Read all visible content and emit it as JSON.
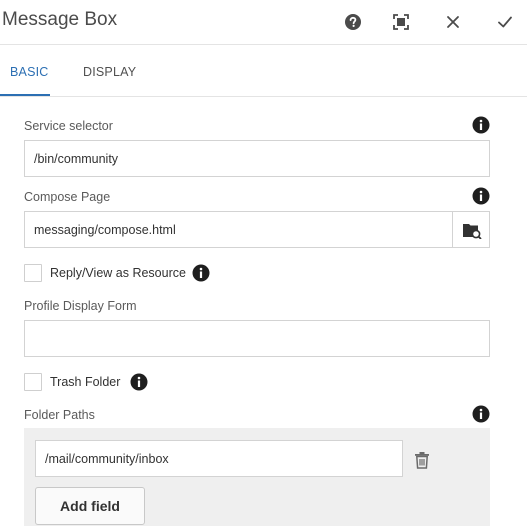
{
  "dialog": {
    "title": "Message Box",
    "toolbar": {
      "help": "help-icon",
      "fullscreen": "fullscreen-icon",
      "close": "close-icon",
      "done": "check-icon"
    }
  },
  "tabs": [
    {
      "label": "BASIC",
      "active": true
    },
    {
      "label": "DISPLAY",
      "active": false
    }
  ],
  "fields": {
    "service_selector": {
      "label": "Service selector",
      "value": "/bin/community"
    },
    "compose_page": {
      "label": "Compose Page",
      "value": "messaging/compose.html"
    },
    "reply_view": {
      "label": "Reply/View as Resource",
      "checked": false
    },
    "profile_display_form": {
      "label": "Profile Display Form",
      "value": ""
    },
    "trash_folder": {
      "label": "Trash Folder",
      "checked": false
    },
    "folder_paths": {
      "label": "Folder Paths",
      "items": [
        "/mail/community/inbox"
      ],
      "add_label": "Add field"
    }
  },
  "colors": {
    "accent": "#2c6fb3",
    "icon": "#4b4b4b"
  }
}
